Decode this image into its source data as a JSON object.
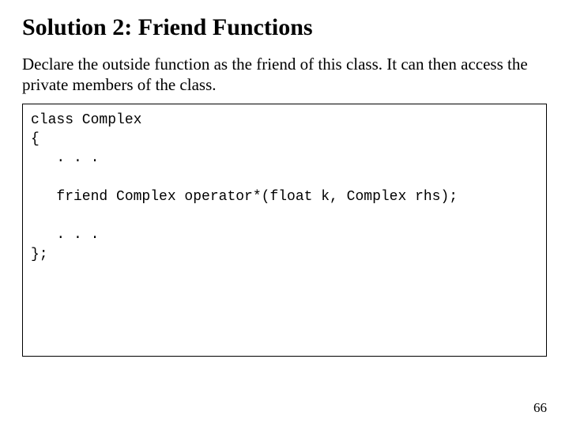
{
  "slide": {
    "title": "Solution 2: Friend Functions",
    "body": "Declare the outside function as the friend of this class. It can then access the private members of the class.",
    "code": "class Complex\n{\n   . . .\n\n   friend Complex operator*(float k, Complex rhs);\n\n   . . .\n};",
    "page_number": "66"
  }
}
